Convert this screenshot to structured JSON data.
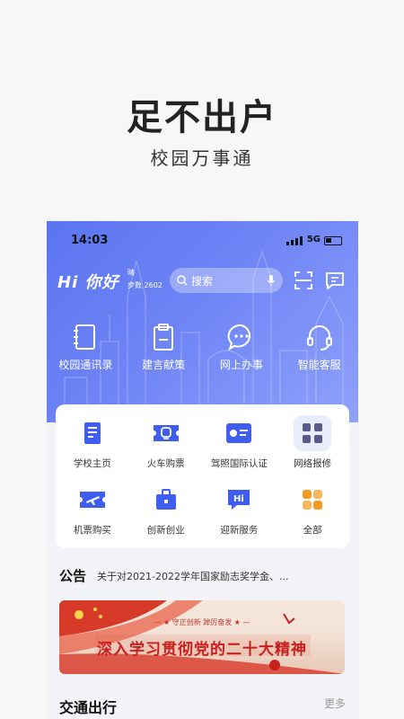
{
  "hero": {
    "title": "足不出户",
    "subtitle": "校园万事通"
  },
  "status": {
    "time": "14:03",
    "network": "5G"
  },
  "header": {
    "logo": "Hi 你好",
    "weather": "晴",
    "steps": "步数 2602",
    "search_placeholder": "搜索"
  },
  "quick": [
    {
      "label": "校园通讯录",
      "icon": "contacts-book-icon"
    },
    {
      "label": "建言献策",
      "icon": "clipboard-icon"
    },
    {
      "label": "网上办事",
      "icon": "chat-bubble-icon"
    },
    {
      "label": "智能客服",
      "icon": "headset-icon"
    }
  ],
  "services": [
    {
      "label": "学校主页",
      "icon": "document-icon"
    },
    {
      "label": "火车购票",
      "icon": "train-ticket-icon"
    },
    {
      "label": "驾照国际认证",
      "icon": "id-card-icon"
    },
    {
      "label": "网络报修",
      "icon": "grid-apps-icon"
    },
    {
      "label": "机票购买",
      "icon": "plane-ticket-icon"
    },
    {
      "label": "创新创业",
      "icon": "briefcase-icon"
    },
    {
      "label": "迎新服务",
      "icon": "hi-chat-icon"
    },
    {
      "label": "全部",
      "icon": "all-apps-icon"
    }
  ],
  "notice": {
    "tag": "公告",
    "text": "关于对2021-2022学年国家励志奖学金、..."
  },
  "banner": {
    "small": "— ★ 守正创新 踔厉奋发 ★ —",
    "slogan": "深入学习贯彻党的二十大精神"
  },
  "traffic": {
    "title": "交通出行",
    "more": "更多"
  },
  "colors": {
    "primary": "#5b75f0",
    "service_blue": "#3f5df0",
    "service_orange": "#f59a23",
    "banner_red": "#c81f1f"
  }
}
